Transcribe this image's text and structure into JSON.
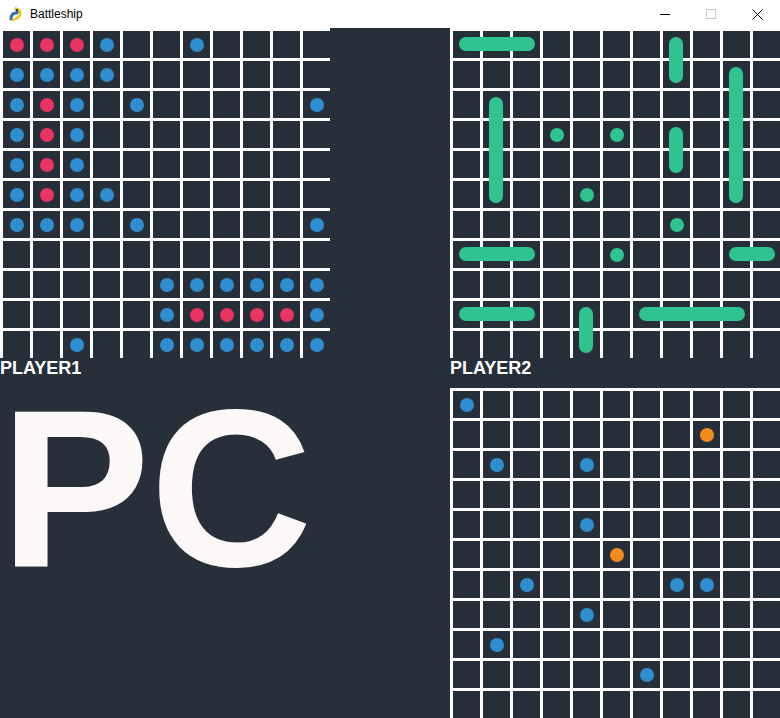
{
  "window": {
    "title": "Battleship"
  },
  "pc_label": "PC",
  "boards": [
    {
      "label": "PLAYER1",
      "ships": [],
      "marks": [
        {
          "row": 0,
          "col": 0,
          "color": "#ea3360"
        },
        {
          "row": 0,
          "col": 1,
          "color": "#ea3360"
        },
        {
          "row": 0,
          "col": 2,
          "color": "#ea3360"
        },
        {
          "row": 0,
          "col": 3,
          "color": "#2e8ecf"
        },
        {
          "row": 0,
          "col": 6,
          "color": "#2e8ecf"
        },
        {
          "row": 1,
          "col": 0,
          "color": "#2e8ecf"
        },
        {
          "row": 1,
          "col": 1,
          "color": "#2e8ecf"
        },
        {
          "row": 1,
          "col": 2,
          "color": "#2e8ecf"
        },
        {
          "row": 1,
          "col": 3,
          "color": "#2e8ecf"
        },
        {
          "row": 2,
          "col": 0,
          "color": "#2e8ecf"
        },
        {
          "row": 2,
          "col": 1,
          "color": "#ea3360"
        },
        {
          "row": 2,
          "col": 2,
          "color": "#2e8ecf"
        },
        {
          "row": 2,
          "col": 4,
          "color": "#2e8ecf"
        },
        {
          "row": 2,
          "col": 10,
          "color": "#2e8ecf"
        },
        {
          "row": 3,
          "col": 0,
          "color": "#2e8ecf"
        },
        {
          "row": 3,
          "col": 1,
          "color": "#ea3360"
        },
        {
          "row": 3,
          "col": 2,
          "color": "#2e8ecf"
        },
        {
          "row": 4,
          "col": 0,
          "color": "#2e8ecf"
        },
        {
          "row": 4,
          "col": 1,
          "color": "#ea3360"
        },
        {
          "row": 4,
          "col": 2,
          "color": "#2e8ecf"
        },
        {
          "row": 5,
          "col": 0,
          "color": "#2e8ecf"
        },
        {
          "row": 5,
          "col": 1,
          "color": "#ea3360"
        },
        {
          "row": 5,
          "col": 2,
          "color": "#2e8ecf"
        },
        {
          "row": 5,
          "col": 3,
          "color": "#2e8ecf"
        },
        {
          "row": 6,
          "col": 0,
          "color": "#2e8ecf"
        },
        {
          "row": 6,
          "col": 1,
          "color": "#2e8ecf"
        },
        {
          "row": 6,
          "col": 2,
          "color": "#2e8ecf"
        },
        {
          "row": 6,
          "col": 4,
          "color": "#2e8ecf"
        },
        {
          "row": 6,
          "col": 10,
          "color": "#2e8ecf"
        },
        {
          "row": 8,
          "col": 5,
          "color": "#2e8ecf"
        },
        {
          "row": 8,
          "col": 6,
          "color": "#2e8ecf"
        },
        {
          "row": 8,
          "col": 7,
          "color": "#2e8ecf"
        },
        {
          "row": 8,
          "col": 8,
          "color": "#2e8ecf"
        },
        {
          "row": 8,
          "col": 9,
          "color": "#2e8ecf"
        },
        {
          "row": 8,
          "col": 10,
          "color": "#2e8ecf"
        },
        {
          "row": 9,
          "col": 5,
          "color": "#2e8ecf"
        },
        {
          "row": 9,
          "col": 6,
          "color": "#ea3360"
        },
        {
          "row": 9,
          "col": 7,
          "color": "#ea3360"
        },
        {
          "row": 9,
          "col": 8,
          "color": "#ea3360"
        },
        {
          "row": 9,
          "col": 9,
          "color": "#ea3360"
        },
        {
          "row": 9,
          "col": 10,
          "color": "#2e8ecf"
        },
        {
          "row": 10,
          "col": 2,
          "color": "#2e8ecf"
        },
        {
          "row": 10,
          "col": 5,
          "color": "#2e8ecf"
        },
        {
          "row": 10,
          "col": 6,
          "color": "#2e8ecf"
        },
        {
          "row": 10,
          "col": 7,
          "color": "#2e8ecf"
        },
        {
          "row": 10,
          "col": 8,
          "color": "#2e8ecf"
        },
        {
          "row": 10,
          "col": 9,
          "color": "#2e8ecf"
        },
        {
          "row": 10,
          "col": 10,
          "color": "#2e8ecf"
        }
      ]
    },
    {
      "label": "PLAYER2",
      "ships": [
        {
          "row": 0,
          "col": 0,
          "length": 3,
          "kind": "horizontal",
          "color": "#2fc48f"
        },
        {
          "row": 0,
          "col": 7,
          "length": 2,
          "kind": "vertical",
          "color": "#2fc48f"
        },
        {
          "row": 1,
          "col": 9,
          "length": 5,
          "kind": "vertical",
          "color": "#2fc48f"
        },
        {
          "row": 2,
          "col": 1,
          "length": 4,
          "kind": "vertical",
          "color": "#2fc48f"
        },
        {
          "row": 3,
          "col": 7,
          "length": 2,
          "kind": "vertical",
          "color": "#2fc48f"
        },
        {
          "row": 7,
          "col": 0,
          "length": 3,
          "kind": "horizontal",
          "color": "#2fc48f"
        },
        {
          "row": 7,
          "col": 9,
          "length": 2,
          "kind": "horizontal",
          "color": "#2fc48f"
        },
        {
          "row": 9,
          "col": 0,
          "length": 3,
          "kind": "horizontal",
          "color": "#2fc48f"
        },
        {
          "row": 9,
          "col": 4,
          "length": 2,
          "kind": "vertical",
          "color": "#2fc48f"
        },
        {
          "row": 9,
          "col": 6,
          "length": 4,
          "kind": "horizontal",
          "color": "#2fc48f"
        }
      ],
      "marks": [
        {
          "row": 3,
          "col": 3,
          "color": "#2fc48f"
        },
        {
          "row": 3,
          "col": 5,
          "color": "#2fc48f"
        },
        {
          "row": 5,
          "col": 4,
          "color": "#2fc48f"
        },
        {
          "row": 6,
          "col": 7,
          "color": "#2fc48f"
        },
        {
          "row": 7,
          "col": 5,
          "color": "#2fc48f"
        }
      ]
    },
    {
      "label": "",
      "ships": [],
      "marks": [
        {
          "row": 0,
          "col": 0,
          "color": "#2e8ecf"
        },
        {
          "row": 1,
          "col": 8,
          "color": "#f28b1e"
        },
        {
          "row": 2,
          "col": 1,
          "color": "#2e8ecf"
        },
        {
          "row": 2,
          "col": 4,
          "color": "#2e8ecf"
        },
        {
          "row": 4,
          "col": 4,
          "color": "#2e8ecf"
        },
        {
          "row": 5,
          "col": 5,
          "color": "#f28b1e"
        },
        {
          "row": 6,
          "col": 2,
          "color": "#2e8ecf"
        },
        {
          "row": 6,
          "col": 7,
          "color": "#2e8ecf"
        },
        {
          "row": 6,
          "col": 8,
          "color": "#2e8ecf"
        },
        {
          "row": 7,
          "col": 4,
          "color": "#2e8ecf"
        },
        {
          "row": 8,
          "col": 1,
          "color": "#2e8ecf"
        },
        {
          "row": 9,
          "col": 6,
          "color": "#2e8ecf"
        }
      ]
    }
  ]
}
